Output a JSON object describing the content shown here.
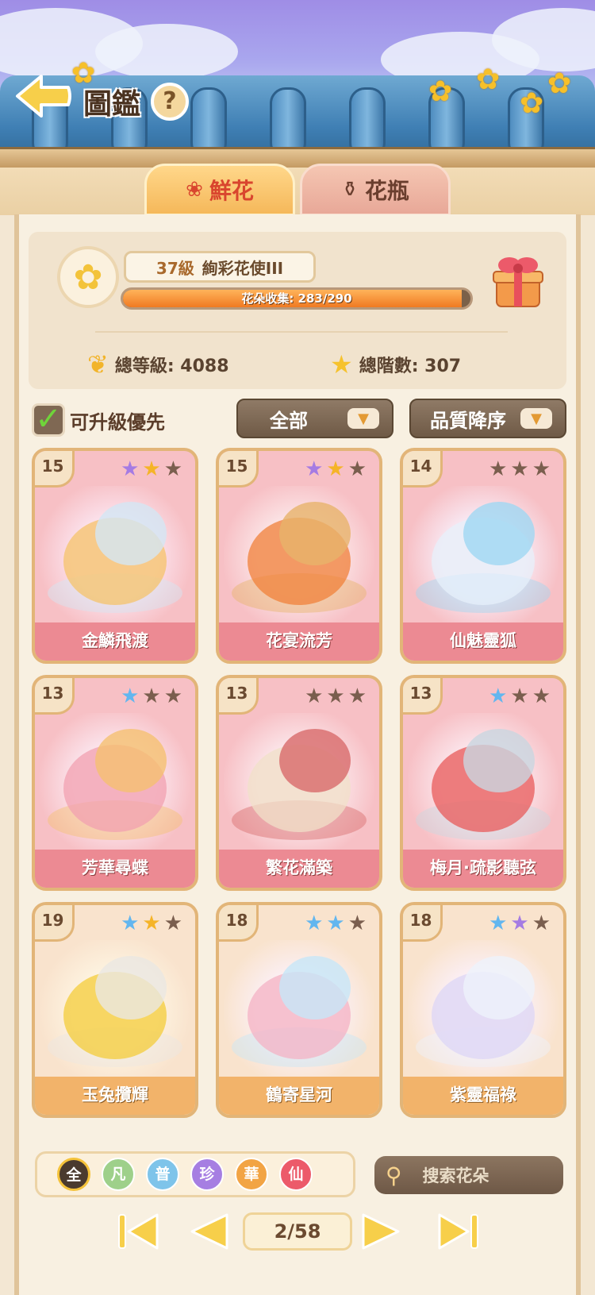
{
  "header": {
    "title": "圖鑑",
    "help_symbol": "?"
  },
  "tabs": [
    {
      "label": "鮮花",
      "icon": "rose-icon",
      "active": true
    },
    {
      "label": "花瓶",
      "icon": "vase-icon",
      "active": false
    }
  ],
  "stats": {
    "level_title": {
      "level": "37級",
      "rank": "絢彩花使III"
    },
    "collection": {
      "text": "花朵收集: 283/290",
      "collected": 283,
      "total": 290
    },
    "total_level": "總等級: 4088",
    "total_stars": "總階數: 307"
  },
  "filters": {
    "upgrade_first_label": "可升級優先",
    "upgrade_first_checked": true,
    "category": "全部",
    "sort": "品質降序"
  },
  "cards": [
    {
      "name": "金鱗飛渡",
      "level": "15",
      "stars": [
        "purple",
        "gold",
        "dark"
      ],
      "theme": "pink"
    },
    {
      "name": "花宴流芳",
      "level": "15",
      "stars": [
        "purple",
        "gold",
        "dark"
      ],
      "theme": "pink"
    },
    {
      "name": "仙魅靈狐",
      "level": "14",
      "stars": [
        "dark",
        "dark",
        "dark"
      ],
      "theme": "pink"
    },
    {
      "name": "芳華尋蝶",
      "level": "13",
      "stars": [
        "blue",
        "dark",
        "dark"
      ],
      "theme": "pink"
    },
    {
      "name": "繁花滿築",
      "level": "13",
      "stars": [
        "dark",
        "dark",
        "dark"
      ],
      "theme": "pink"
    },
    {
      "name": "梅月·疏影聽弦",
      "level": "13",
      "stars": [
        "blue",
        "dark",
        "dark"
      ],
      "theme": "pink"
    },
    {
      "name": "玉兔攬輝",
      "level": "19",
      "stars": [
        "blue",
        "gold",
        "dark"
      ],
      "theme": "peach"
    },
    {
      "name": "鶴寄星河",
      "level": "18",
      "stars": [
        "blue",
        "blue",
        "dark"
      ],
      "theme": "peach"
    },
    {
      "name": "紫靈福祿",
      "level": "18",
      "stars": [
        "blue",
        "purple",
        "dark"
      ],
      "theme": "peach"
    }
  ],
  "rarity_filters": [
    {
      "label": "全",
      "color": "#4a3a2e",
      "selected": true
    },
    {
      "label": "凡",
      "color": "#9ed08a",
      "selected": false
    },
    {
      "label": "普",
      "color": "#7ec4ea",
      "selected": false
    },
    {
      "label": "珍",
      "color": "#a67ee2",
      "selected": false
    },
    {
      "label": "華",
      "color": "#f2a444",
      "selected": false
    },
    {
      "label": "仙",
      "color": "#ec5a6a",
      "selected": false
    }
  ],
  "search": {
    "placeholder": "搜索花朵"
  },
  "pagination": {
    "current": "2/58"
  },
  "colors": {
    "star_purple": "#a57be3",
    "star_gold": "#f5b428",
    "star_blue": "#62b6ef",
    "star_dark": "#7a5e4e"
  }
}
